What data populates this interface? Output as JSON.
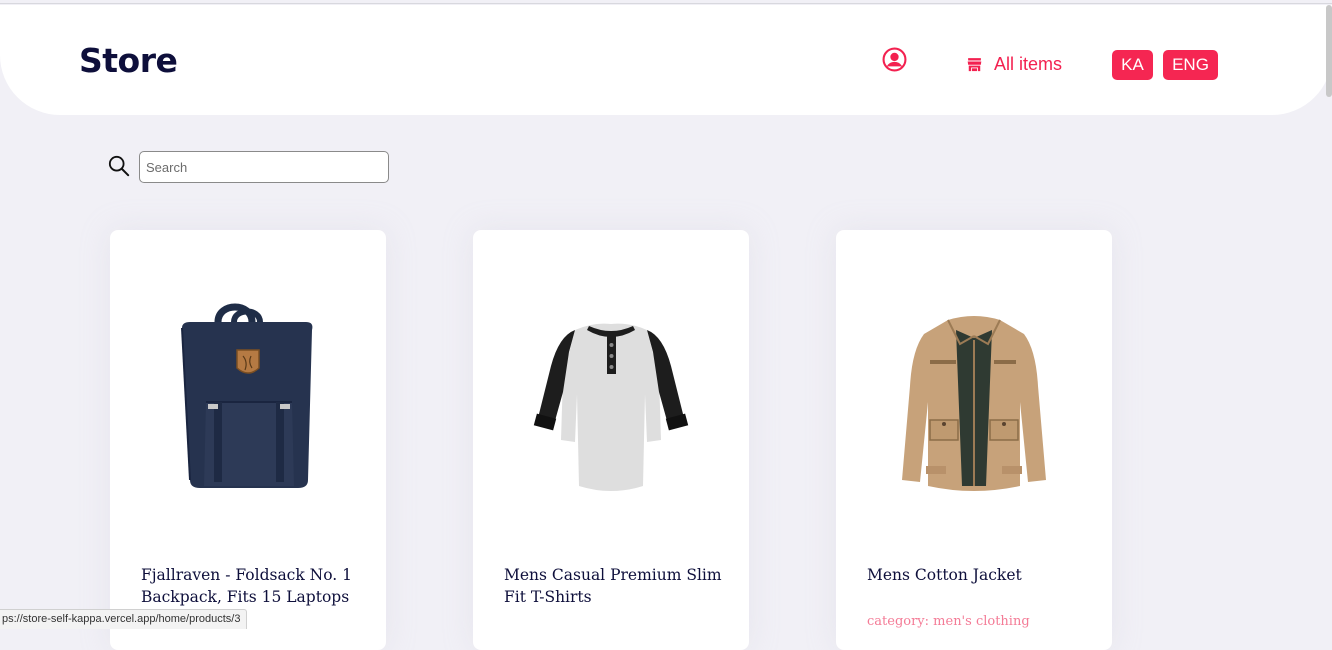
{
  "header": {
    "logo": "Store",
    "all_items_label": "All items",
    "languages": [
      "KA",
      "ENG"
    ]
  },
  "search": {
    "placeholder": "Search",
    "value": ""
  },
  "products": [
    {
      "title": "Fjallraven - Foldsack No. 1 Backpack, Fits 15 Laptops",
      "category": "",
      "image": "backpack"
    },
    {
      "title": "Mens Casual Premium Slim Fit T-Shirts",
      "category": "",
      "image": "henley-shirt"
    },
    {
      "title": "Mens Cotton Jacket",
      "category": "category: men's clothing",
      "image": "cotton-jacket"
    }
  ],
  "status_bar": {
    "url": "ps://store-self-kappa.vercel.app/home/products/3"
  },
  "colors": {
    "accent": "#f52652",
    "logo": "#0e0f3b",
    "background": "#f1f0f6",
    "category_text": "#f47b96"
  }
}
